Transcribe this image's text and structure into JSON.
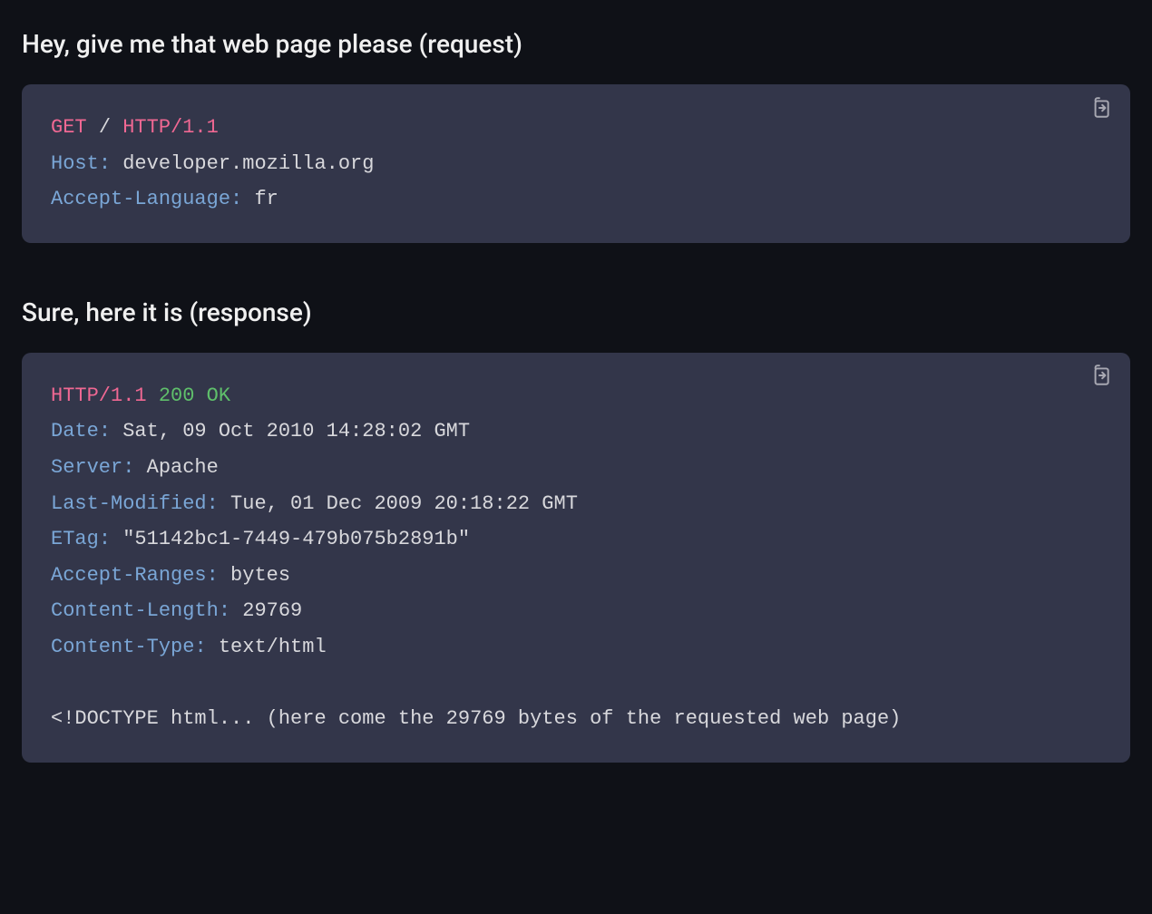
{
  "request": {
    "heading": "Hey, give me that web page please (request)",
    "method": "GET",
    "path": "/",
    "protocol": "HTTP/1.1",
    "headers": [
      {
        "name": "Host",
        "value": "developer.mozilla.org"
      },
      {
        "name": "Accept-Language",
        "value": "fr"
      }
    ]
  },
  "response": {
    "heading": "Sure, here it is (response)",
    "protocol": "HTTP/1.1",
    "status_code": "200",
    "status_text": "OK",
    "headers": [
      {
        "name": "Date",
        "value": "Sat, 09 Oct 2010 14:28:02 GMT"
      },
      {
        "name": "Server",
        "value": "Apache"
      },
      {
        "name": "Last-Modified",
        "value": "Tue, 01 Dec 2009 20:18:22 GMT"
      },
      {
        "name": "ETag",
        "value": "\"51142bc1-7449-479b075b2891b\""
      },
      {
        "name": "Accept-Ranges",
        "value": "bytes"
      },
      {
        "name": "Content-Length",
        "value": "29769"
      },
      {
        "name": "Content-Type",
        "value": "text/html"
      }
    ],
    "body_note": "<!DOCTYPE html... (here come the 29769 bytes of the requested web page)"
  },
  "ui": {
    "copy_label": "Copy to clipboard"
  }
}
